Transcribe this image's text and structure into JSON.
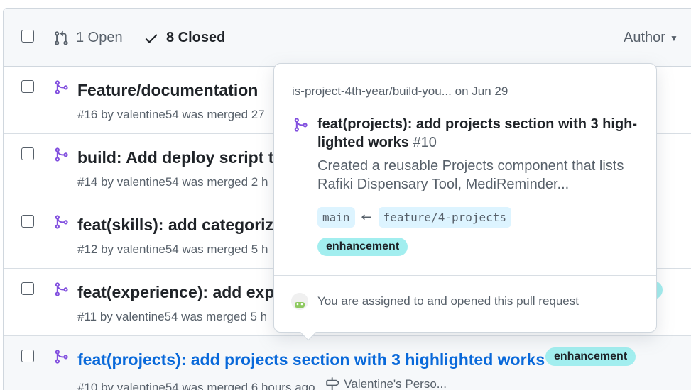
{
  "header": {
    "open_label": "1 Open",
    "closed_label": "8 Closed",
    "author_label": "Author"
  },
  "rows": [
    {
      "title": "Feature/documentation",
      "meta": "#16 by valentine54 was merged 27"
    },
    {
      "title": "build: Add deploy script t",
      "meta": "#14 by valentine54 was merged 2 h"
    },
    {
      "title": "feat(skills): add categorize",
      "meta": "#12 by valentine54 was merged 5 h"
    },
    {
      "title": "feat(experience): add exp",
      "meta": "#11 by valentine54 was merged 5 h",
      "label_fragment": "ent"
    },
    {
      "title": "feat(projects): add projects section with 3 highlighted works",
      "label": "enhancement",
      "meta": "#10 by valentine54 was merged 6 hours ago",
      "milestone": "Valentine's Perso..."
    }
  ],
  "popover": {
    "repo": "is-project-4th-year/build-you...",
    "date": "on Jun 29",
    "title": "feat(projects): add projects section with 3 high-lighted works",
    "number": "#10",
    "body": "Created a reusable Projects component that lists Rafiki Dispensary Tool, MediReminder...",
    "base_branch": "main",
    "head_branch": "feature/4-projects",
    "label": "enhancement",
    "footer": "You are assigned to and opened this pull request"
  },
  "colors": {
    "merged_purple": "#8250df",
    "link_blue": "#0969da",
    "label_bg": "#a2eeef",
    "branch_bg": "#ddf4ff"
  }
}
